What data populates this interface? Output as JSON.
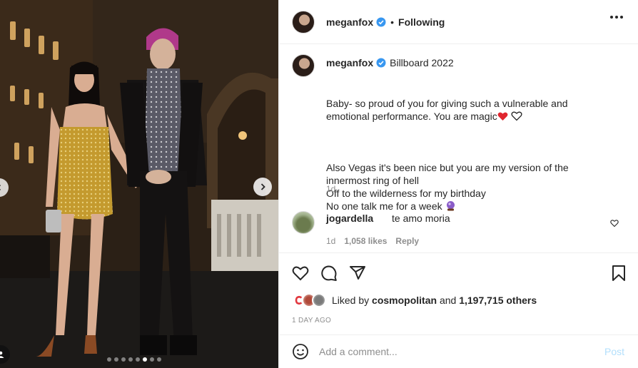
{
  "colors": {
    "verified": "#3897f0",
    "heart": "#ed4956",
    "post_disabled": "#b2dffc",
    "muted": "#8e8e8e"
  },
  "photo": {
    "image_index": 6,
    "image_count": 8
  },
  "header": {
    "username": "meganfox",
    "separator": "•",
    "follow_state": "Following"
  },
  "caption": {
    "username": "meganfox",
    "title": "Billboard 2022",
    "text_line1": "Baby- so proud of you for giving such a vulnerable and emotional performance. You are magic",
    "text_line2": "Also Vegas it's been nice but you are my version of the innermost ring of hell\nOff to the wilderness for my birthday\nNo one talk me for a week ",
    "time": "1d"
  },
  "comment": {
    "username": "jogardella",
    "text": "te amo moria",
    "time": "1d",
    "likes": "1,058 likes",
    "reply": "Reply"
  },
  "likes": {
    "prefix": "Liked by",
    "user": "cosmopolitan",
    "middle": "and",
    "count": "1,197,715 others"
  },
  "date": "1 DAY AGO",
  "add_comment": {
    "placeholder": "Add a comment...",
    "post_label": "Post"
  },
  "icons": {
    "more": "more-options-icon",
    "like": "heart-icon",
    "comment": "comment-icon",
    "share": "share-icon",
    "save": "bookmark-icon",
    "emoji": "emoji-icon"
  }
}
